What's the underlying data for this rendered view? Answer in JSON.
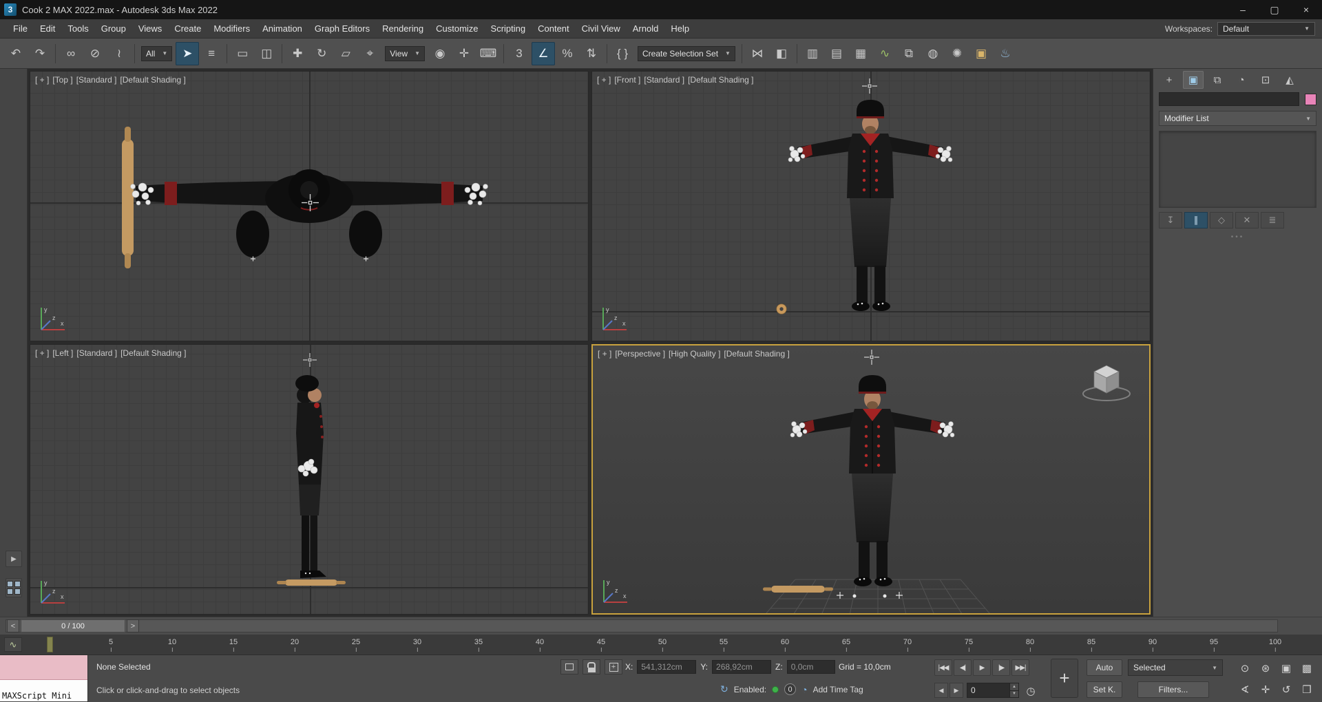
{
  "titlebar": {
    "app_badge": "3",
    "title": "Cook 2 MAX 2022.max - Autodesk 3ds Max 2022",
    "controls": [
      {
        "name": "minimize-button",
        "glyph": "–"
      },
      {
        "name": "maximize-button",
        "glyph": "▢"
      },
      {
        "name": "close-button",
        "glyph": "×"
      }
    ]
  },
  "menubar": {
    "items": [
      "File",
      "Edit",
      "Tools",
      "Group",
      "Views",
      "Create",
      "Modifiers",
      "Animation",
      "Graph Editors",
      "Rendering",
      "Customize",
      "Scripting",
      "Content",
      "Civil View",
      "Arnold",
      "Help"
    ],
    "workspaces_label": "Workspaces:",
    "workspace_value": "Default"
  },
  "toolbar": {
    "items": [
      {
        "type": "icon",
        "name": "undo-icon",
        "glyph": "↶"
      },
      {
        "type": "icon",
        "name": "redo-icon",
        "glyph": "↷"
      },
      {
        "type": "sep"
      },
      {
        "type": "icon",
        "name": "select-and-link-icon",
        "glyph": "∞"
      },
      {
        "type": "icon",
        "name": "unlink-selection-icon",
        "glyph": "⊘"
      },
      {
        "type": "icon",
        "name": "bind-to-space-warp-icon",
        "glyph": "≀"
      },
      {
        "type": "sep"
      },
      {
        "type": "dropdown",
        "name": "selection-filter-dropdown",
        "value": "All"
      },
      {
        "type": "icon",
        "name": "select-object-icon",
        "glyph": "➤",
        "active": true
      },
      {
        "type": "icon",
        "name": "select-by-name-icon",
        "glyph": "≡"
      },
      {
        "type": "sep"
      },
      {
        "type": "icon",
        "name": "rectangular-selection-region-icon",
        "glyph": "▭"
      },
      {
        "type": "icon",
        "name": "window-crossing-icon",
        "glyph": "◫"
      },
      {
        "type": "sep"
      },
      {
        "type": "icon",
        "name": "select-and-move-icon",
        "glyph": "✚"
      },
      {
        "type": "icon",
        "name": "select-and-rotate-icon",
        "glyph": "↻"
      },
      {
        "type": "icon",
        "name": "select-and-uniform-scale-icon",
        "glyph": "▱"
      },
      {
        "type": "icon",
        "name": "select-and-place-icon",
        "glyph": "⌖"
      },
      {
        "type": "dropdown",
        "name": "reference-coordinate-system-dropdown",
        "value": "View"
      },
      {
        "type": "icon",
        "name": "use-pivot-point-center-icon",
        "glyph": "◉"
      },
      {
        "type": "icon",
        "name": "select-and-manipulate-icon",
        "glyph": "✛"
      },
      {
        "type": "icon",
        "name": "keyboard-shortcut-override-icon",
        "glyph": "⌨"
      },
      {
        "type": "sep"
      },
      {
        "type": "icon",
        "name": "snaps-toggle-icon",
        "glyph": "3"
      },
      {
        "type": "icon",
        "name": "angle-snap-toggle-icon",
        "glyph": "∠",
        "active": true
      },
      {
        "type": "icon",
        "name": "percent-snap-toggle-icon",
        "glyph": "%"
      },
      {
        "type": "icon",
        "name": "spinner-snap-toggle-icon",
        "glyph": "⇅"
      },
      {
        "type": "sep"
      },
      {
        "type": "icon",
        "name": "edit-named-selection-sets-icon",
        "glyph": "{ }"
      },
      {
        "type": "dropdown",
        "name": "named-selection-sets-dropdown",
        "value": "Create Selection Set"
      },
      {
        "type": "sep"
      },
      {
        "type": "icon",
        "name": "mirror-icon",
        "glyph": "⋈"
      },
      {
        "type": "icon",
        "name": "align-icon",
        "glyph": "◧"
      },
      {
        "type": "sep"
      },
      {
        "type": "icon",
        "name": "toggle-scene-explorer-icon",
        "glyph": "▥"
      },
      {
        "type": "icon",
        "name": "toggle-layer-explorer-icon",
        "glyph": "▤"
      },
      {
        "type": "icon",
        "name": "toggle-ribbon-icon",
        "glyph": "▦"
      },
      {
        "type": "icon",
        "name": "curve-editor-icon",
        "glyph": "∿",
        "color": "#9dc068"
      },
      {
        "type": "icon",
        "name": "schematic-view-icon",
        "glyph": "⧉"
      },
      {
        "type": "icon",
        "name": "material-editor-icon",
        "glyph": "◍"
      },
      {
        "type": "icon",
        "name": "render-setup-icon",
        "glyph": "✺"
      },
      {
        "type": "icon",
        "name": "rendered-frame-window-icon",
        "glyph": "▣",
        "color": "#d8b46a"
      },
      {
        "type": "icon",
        "name": "render-production-icon",
        "glyph": "♨",
        "color": "#8fb6d6"
      }
    ]
  },
  "viewports": [
    {
      "id": "top",
      "menus": [
        "[ + ]",
        "[Top ]",
        "[Standard ]",
        "[Default Shading ]"
      ]
    },
    {
      "id": "front",
      "menus": [
        "[ + ]",
        "[Front ]",
        "[Standard ]",
        "[Default Shading ]"
      ]
    },
    {
      "id": "left",
      "menus": [
        "[ + ]",
        "[Left ]",
        "[Standard ]",
        "[Default Shading ]"
      ]
    },
    {
      "id": "persp",
      "menus": [
        "[ + ]",
        "[Perspective ]",
        "[High Quality ]",
        "[Default Shading ]"
      ],
      "active": true
    }
  ],
  "trackbar": {
    "step_back": "<",
    "frame_display": "0 / 100",
    "step_forward": ">"
  },
  "timeline": {
    "mini_curve_glyph": "∿",
    "tick_labels": [
      5,
      10,
      15,
      20,
      25,
      30,
      35,
      40,
      45,
      50,
      55,
      60,
      65,
      70,
      75,
      80,
      85,
      90,
      95,
      100
    ]
  },
  "statusbar": {
    "maxscript_label": "MAXScript Mini",
    "selection_status": "None Selected",
    "prompt": "Click or click-and-drag to select objects",
    "selection_icons": [
      {
        "name": "isolate-selection-toggle-button",
        "icon": "isolate-selection-icon"
      },
      {
        "name": "selection-lock-toggle-button",
        "icon": "selection-lock-icon"
      },
      {
        "name": "absolute-mode-toggle-button",
        "icon": "absolute-mode-icon"
      }
    ],
    "coordinates": {
      "x_label": "X:",
      "x_value": "541,312cm",
      "y_label": "Y:",
      "y_value": "268,92cm",
      "z_label": "Z:",
      "z_value": "0,0cm"
    },
    "grid_display": "Grid = 10,0cm",
    "enabled_row": {
      "sync_glyph": "↻",
      "enabled_label": "Enabled:",
      "count": "0",
      "clock_glyph": "◔",
      "add_time_tag": "Add Time Tag"
    }
  },
  "animation": {
    "transport": [
      {
        "name": "go-to-start-button",
        "glyph": "|◀◀"
      },
      {
        "name": "previous-frame-button",
        "glyph": "◀|"
      },
      {
        "name": "play-button",
        "glyph": "▶"
      },
      {
        "name": "next-frame-button",
        "glyph": "|▶"
      },
      {
        "name": "go-to-end-button",
        "glyph": "▶▶|"
      }
    ],
    "key_steppers": [
      {
        "name": "previous-key-button",
        "glyph": "◀"
      },
      {
        "name": "next-key-button",
        "glyph": "▶"
      }
    ],
    "time_value": "0",
    "set_keys_glyph": "+",
    "auto_key_label": "Auto",
    "set_key_label": "Set K.",
    "key_filter_value": "Selected",
    "filters_label": "Filters...",
    "time_config_glyph": "◷"
  },
  "navigation": [
    {
      "name": "zoom-icon",
      "glyph": "⊙"
    },
    {
      "name": "zoom-all-icon",
      "glyph": "⊛"
    },
    {
      "name": "zoom-extents-icon",
      "glyph": "▣"
    },
    {
      "name": "zoom-extents-all-icon",
      "glyph": "▩"
    },
    {
      "name": "field-of-view-icon",
      "glyph": "∢"
    },
    {
      "name": "pan-icon",
      "glyph": "✛"
    },
    {
      "name": "orbit-icon",
      "glyph": "↺"
    },
    {
      "name": "maximize-viewport-toggle-icon",
      "glyph": "❒"
    }
  ],
  "left_strip": {
    "expand_glyph": "▶"
  },
  "command_panel": {
    "tabs": [
      {
        "name": "create-tab",
        "glyph": "+"
      },
      {
        "name": "modify-tab",
        "glyph": "▣",
        "active": true
      },
      {
        "name": "hierarchy-tab",
        "glyph": "⧉"
      },
      {
        "name": "motion-tab",
        "glyph": "◔"
      },
      {
        "name": "display-tab",
        "glyph": "⊡"
      },
      {
        "name": "utilities-tab",
        "glyph": "◭"
      }
    ],
    "object_color": "#e884b8",
    "modifier_list_label": "Modifier List",
    "stack_buttons": [
      {
        "name": "pin-stack-button",
        "glyph": "↧"
      },
      {
        "name": "show-end-result-button",
        "glyph": "∥",
        "active": true
      },
      {
        "name": "make-unique-button",
        "glyph": "◇"
      },
      {
        "name": "remove-modifier-button",
        "glyph": "✕"
      },
      {
        "name": "configure-modifier-sets-button",
        "glyph": "≣"
      }
    ]
  }
}
